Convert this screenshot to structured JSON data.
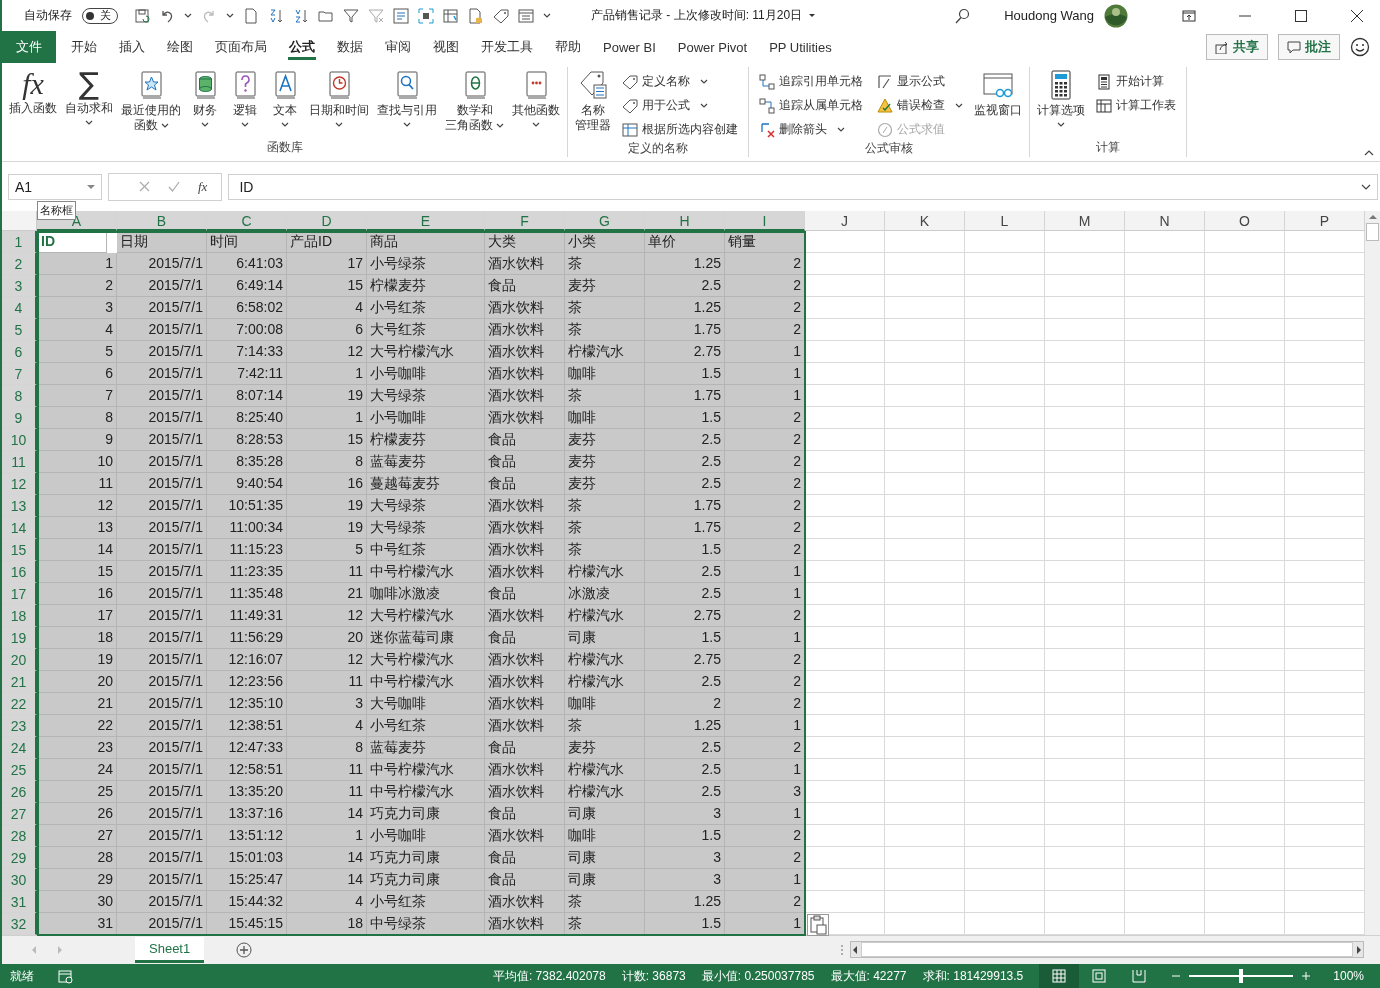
{
  "title_bar": {
    "autosave_label": "自动保存",
    "autosave_toggle": {
      "on": false,
      "label": "关"
    },
    "title": "产品销售记录 - 上次修改时间: 11月20日",
    "user": "Houdong Wang"
  },
  "tabs": [
    {
      "label": "文件",
      "kind": "file",
      "selected": false
    },
    {
      "label": "开始",
      "kind": "tab",
      "selected": false
    },
    {
      "label": "插入",
      "kind": "tab",
      "selected": false
    },
    {
      "label": "绘图",
      "kind": "tab",
      "selected": false
    },
    {
      "label": "页面布局",
      "kind": "tab",
      "selected": false
    },
    {
      "label": "公式",
      "kind": "tab",
      "selected": true
    },
    {
      "label": "数据",
      "kind": "tab",
      "selected": false
    },
    {
      "label": "审阅",
      "kind": "tab",
      "selected": false
    },
    {
      "label": "视图",
      "kind": "tab",
      "selected": false
    },
    {
      "label": "开发工具",
      "kind": "tab",
      "selected": false
    },
    {
      "label": "帮助",
      "kind": "tab",
      "selected": false
    },
    {
      "label": "Power BI",
      "kind": "tab",
      "selected": false
    },
    {
      "label": "Power Pivot",
      "kind": "tab",
      "selected": false
    },
    {
      "label": "PP Utilities",
      "kind": "tab",
      "selected": false
    }
  ],
  "actions": [
    {
      "label": "共享"
    },
    {
      "label": "批注"
    }
  ],
  "ribbon": {
    "groups": [
      {
        "label": "函数库",
        "items": [
          {
            "kind": "large",
            "glyph": "fx",
            "lines": [
              "插入函数"
            ],
            "caret": false
          },
          {
            "kind": "large",
            "glyph": "∑",
            "lines": [
              "自动求和"
            ],
            "caret": true
          },
          {
            "kind": "large",
            "lines": [
              "最近使用的",
              "函数"
            ],
            "caret": true
          },
          {
            "kind": "large",
            "lines": [
              "财务"
            ],
            "caret": true
          },
          {
            "kind": "large",
            "lines": [
              "逻辑"
            ],
            "caret": true
          },
          {
            "kind": "large",
            "lines": [
              "文本"
            ],
            "caret": true
          },
          {
            "kind": "large",
            "lines": [
              "日期和时间"
            ],
            "caret": true
          },
          {
            "kind": "large",
            "lines": [
              "查找与引用"
            ],
            "caret": true
          },
          {
            "kind": "large",
            "lines": [
              "数学和",
              "三角函数"
            ],
            "caret": true
          },
          {
            "kind": "large",
            "lines": [
              "其他函数"
            ],
            "caret": true
          }
        ]
      },
      {
        "label": "定义的名称",
        "items": [
          {
            "kind": "large",
            "lines": [
              "名称",
              "管理器"
            ],
            "caret": false
          },
          {
            "kind": "stack",
            "buttons": [
              {
                "label": "定义名称",
                "caret": true,
                "disabled": false
              },
              {
                "label": "用于公式",
                "caret": true,
                "disabled": false
              },
              {
                "label": "根据所选内容创建",
                "caret": false,
                "disabled": false
              }
            ]
          }
        ]
      },
      {
        "label": "公式审核",
        "items": [
          {
            "kind": "stack",
            "buttons": [
              {
                "label": "追踪引用单元格",
                "caret": false,
                "disabled": false
              },
              {
                "label": "追踪从属单元格",
                "caret": false,
                "disabled": false
              },
              {
                "label": "删除箭头",
                "caret": true,
                "disabled": false
              }
            ]
          },
          {
            "kind": "stack",
            "buttons": [
              {
                "label": "显示公式",
                "caret": false,
                "disabled": false
              },
              {
                "label": "错误检查",
                "caret": true,
                "disabled": false
              },
              {
                "label": "公式求值",
                "caret": false,
                "disabled": true
              }
            ]
          },
          {
            "kind": "large",
            "lines": [
              "监视窗口"
            ],
            "caret": false
          }
        ]
      },
      {
        "label": "计算",
        "items": [
          {
            "kind": "large",
            "lines": [
              "计算选项"
            ],
            "caret": true
          },
          {
            "kind": "stack",
            "buttons": [
              {
                "label": "开始计算",
                "caret": false,
                "disabled": false
              },
              {
                "label": "计算工作表",
                "caret": false,
                "disabled": false
              }
            ]
          }
        ]
      }
    ]
  },
  "formula_bar": {
    "name_box": "A1",
    "name_box_tooltip": "名称框",
    "fx_glyph": "fx",
    "value": "ID"
  },
  "sheet": {
    "columns": [
      {
        "letter": "A",
        "selected": true
      },
      {
        "letter": "B",
        "selected": true
      },
      {
        "letter": "C",
        "selected": true
      },
      {
        "letter": "D",
        "selected": true
      },
      {
        "letter": "E",
        "selected": true
      },
      {
        "letter": "F",
        "selected": true
      },
      {
        "letter": "G",
        "selected": true
      },
      {
        "letter": "H",
        "selected": true
      },
      {
        "letter": "I",
        "selected": true
      },
      {
        "letter": "J",
        "selected": false
      },
      {
        "letter": "K",
        "selected": false
      },
      {
        "letter": "L",
        "selected": false
      },
      {
        "letter": "M",
        "selected": false
      },
      {
        "letter": "N",
        "selected": false
      },
      {
        "letter": "O",
        "selected": false
      },
      {
        "letter": "P",
        "selected": false
      }
    ],
    "rows": [
      {
        "number": "1",
        "selected": true,
        "active": true,
        "cells": [
          "ID",
          "日期",
          "时间",
          "产品ID",
          "商品",
          "大类",
          "小类",
          "单价",
          "销量"
        ]
      },
      {
        "number": "2",
        "selected": true,
        "active": false,
        "cells": [
          "1",
          "2015/7/1",
          "6:41:03",
          "17",
          "小号绿茶",
          "酒水饮料",
          "茶",
          "1.25",
          "2"
        ]
      },
      {
        "number": "3",
        "selected": true,
        "active": false,
        "cells": [
          "2",
          "2015/7/1",
          "6:49:14",
          "15",
          "柠檬麦芬",
          "食品",
          "麦芬",
          "2.5",
          "2"
        ]
      },
      {
        "number": "4",
        "selected": true,
        "active": false,
        "cells": [
          "3",
          "2015/7/1",
          "6:58:02",
          "4",
          "小号红茶",
          "酒水饮料",
          "茶",
          "1.25",
          "2"
        ]
      },
      {
        "number": "5",
        "selected": true,
        "active": false,
        "cells": [
          "4",
          "2015/7/1",
          "7:00:08",
          "6",
          "大号红茶",
          "酒水饮料",
          "茶",
          "1.75",
          "2"
        ]
      },
      {
        "number": "6",
        "selected": true,
        "active": false,
        "cells": [
          "5",
          "2015/7/1",
          "7:14:33",
          "12",
          "大号柠檬汽水",
          "酒水饮料",
          "柠檬汽水",
          "2.75",
          "1"
        ]
      },
      {
        "number": "7",
        "selected": true,
        "active": false,
        "cells": [
          "6",
          "2015/7/1",
          "7:42:11",
          "1",
          "小号咖啡",
          "酒水饮料",
          "咖啡",
          "1.5",
          "1"
        ]
      },
      {
        "number": "8",
        "selected": true,
        "active": false,
        "cells": [
          "7",
          "2015/7/1",
          "8:07:14",
          "19",
          "大号绿茶",
          "酒水饮料",
          "茶",
          "1.75",
          "1"
        ]
      },
      {
        "number": "9",
        "selected": true,
        "active": false,
        "cells": [
          "8",
          "2015/7/1",
          "8:25:40",
          "1",
          "小号咖啡",
          "酒水饮料",
          "咖啡",
          "1.5",
          "2"
        ]
      },
      {
        "number": "10",
        "selected": true,
        "active": false,
        "cells": [
          "9",
          "2015/7/1",
          "8:28:53",
          "15",
          "柠檬麦芬",
          "食品",
          "麦芬",
          "2.5",
          "2"
        ]
      },
      {
        "number": "11",
        "selected": true,
        "active": false,
        "cells": [
          "10",
          "2015/7/1",
          "8:35:28",
          "8",
          "蓝莓麦芬",
          "食品",
          "麦芬",
          "2.5",
          "2"
        ]
      },
      {
        "number": "12",
        "selected": true,
        "active": false,
        "cells": [
          "11",
          "2015/7/1",
          "9:40:54",
          "16",
          "蔓越莓麦芬",
          "食品",
          "麦芬",
          "2.5",
          "2"
        ]
      },
      {
        "number": "13",
        "selected": true,
        "active": false,
        "cells": [
          "12",
          "2015/7/1",
          "10:51:35",
          "19",
          "大号绿茶",
          "酒水饮料",
          "茶",
          "1.75",
          "2"
        ]
      },
      {
        "number": "14",
        "selected": true,
        "active": false,
        "cells": [
          "13",
          "2015/7/1",
          "11:00:34",
          "19",
          "大号绿茶",
          "酒水饮料",
          "茶",
          "1.75",
          "2"
        ]
      },
      {
        "number": "15",
        "selected": true,
        "active": false,
        "cells": [
          "14",
          "2015/7/1",
          "11:15:23",
          "5",
          "中号红茶",
          "酒水饮料",
          "茶",
          "1.5",
          "2"
        ]
      },
      {
        "number": "16",
        "selected": true,
        "active": false,
        "cells": [
          "15",
          "2015/7/1",
          "11:23:35",
          "11",
          "中号柠檬汽水",
          "酒水饮料",
          "柠檬汽水",
          "2.5",
          "1"
        ]
      },
      {
        "number": "17",
        "selected": true,
        "active": false,
        "cells": [
          "16",
          "2015/7/1",
          "11:35:48",
          "21",
          "咖啡冰激凌",
          "食品",
          "冰激凌",
          "2.5",
          "1"
        ]
      },
      {
        "number": "18",
        "selected": true,
        "active": false,
        "cells": [
          "17",
          "2015/7/1",
          "11:49:31",
          "12",
          "大号柠檬汽水",
          "酒水饮料",
          "柠檬汽水",
          "2.75",
          "2"
        ]
      },
      {
        "number": "19",
        "selected": true,
        "active": false,
        "cells": [
          "18",
          "2015/7/1",
          "11:56:29",
          "20",
          "迷你蓝莓司康",
          "食品",
          "司康",
          "1.5",
          "1"
        ]
      },
      {
        "number": "20",
        "selected": true,
        "active": false,
        "cells": [
          "19",
          "2015/7/1",
          "12:16:07",
          "12",
          "大号柠檬汽水",
          "酒水饮料",
          "柠檬汽水",
          "2.75",
          "2"
        ]
      },
      {
        "number": "21",
        "selected": true,
        "active": false,
        "cells": [
          "20",
          "2015/7/1",
          "12:23:56",
          "11",
          "中号柠檬汽水",
          "酒水饮料",
          "柠檬汽水",
          "2.5",
          "2"
        ]
      },
      {
        "number": "22",
        "selected": true,
        "active": false,
        "cells": [
          "21",
          "2015/7/1",
          "12:35:10",
          "3",
          "大号咖啡",
          "酒水饮料",
          "咖啡",
          "2",
          "2"
        ]
      },
      {
        "number": "23",
        "selected": true,
        "active": false,
        "cells": [
          "22",
          "2015/7/1",
          "12:38:51",
          "4",
          "小号红茶",
          "酒水饮料",
          "茶",
          "1.25",
          "1"
        ]
      },
      {
        "number": "24",
        "selected": true,
        "active": false,
        "cells": [
          "23",
          "2015/7/1",
          "12:47:33",
          "8",
          "蓝莓麦芬",
          "食品",
          "麦芬",
          "2.5",
          "2"
        ]
      },
      {
        "number": "25",
        "selected": true,
        "active": false,
        "cells": [
          "24",
          "2015/7/1",
          "12:58:51",
          "11",
          "中号柠檬汽水",
          "酒水饮料",
          "柠檬汽水",
          "2.5",
          "1"
        ]
      },
      {
        "number": "26",
        "selected": true,
        "active": false,
        "cells": [
          "25",
          "2015/7/1",
          "13:35:20",
          "11",
          "中号柠檬汽水",
          "酒水饮料",
          "柠檬汽水",
          "2.5",
          "3"
        ]
      },
      {
        "number": "27",
        "selected": true,
        "active": false,
        "cells": [
          "26",
          "2015/7/1",
          "13:37:16",
          "14",
          "巧克力司康",
          "食品",
          "司康",
          "3",
          "1"
        ]
      },
      {
        "number": "28",
        "selected": true,
        "active": false,
        "cells": [
          "27",
          "2015/7/1",
          "13:51:12",
          "1",
          "小号咖啡",
          "酒水饮料",
          "咖啡",
          "1.5",
          "2"
        ]
      },
      {
        "number": "29",
        "selected": true,
        "active": false,
        "cells": [
          "28",
          "2015/7/1",
          "15:01:03",
          "14",
          "巧克力司康",
          "食品",
          "司康",
          "3",
          "2"
        ]
      },
      {
        "number": "30",
        "selected": true,
        "active": false,
        "cells": [
          "29",
          "2015/7/1",
          "15:25:47",
          "14",
          "巧克力司康",
          "食品",
          "司康",
          "3",
          "1"
        ]
      },
      {
        "number": "31",
        "selected": true,
        "active": false,
        "cells": [
          "30",
          "2015/7/1",
          "15:44:32",
          "4",
          "小号红茶",
          "酒水饮料",
          "茶",
          "1.25",
          "2"
        ]
      },
      {
        "number": "32",
        "selected": true,
        "active": false,
        "cells": [
          "31",
          "2015/7/1",
          "15:45:15",
          "18",
          "中号绿茶",
          "酒水饮料",
          "茶",
          "1.5",
          "1"
        ]
      }
    ]
  },
  "sheets": [
    {
      "label": "Sheet1",
      "selected": true
    }
  ],
  "status_bar": {
    "mode": "就绪",
    "stats": [
      "平均值: 7382.402078",
      "计数: 36873",
      "最小值: 0.250037785",
      "最大值: 42277",
      "求和: 181429913.5"
    ],
    "views": [
      {
        "selected": true
      },
      {
        "selected": false
      },
      {
        "selected": false
      }
    ],
    "zoom": {
      "level": 0.5,
      "label": "100%"
    }
  }
}
